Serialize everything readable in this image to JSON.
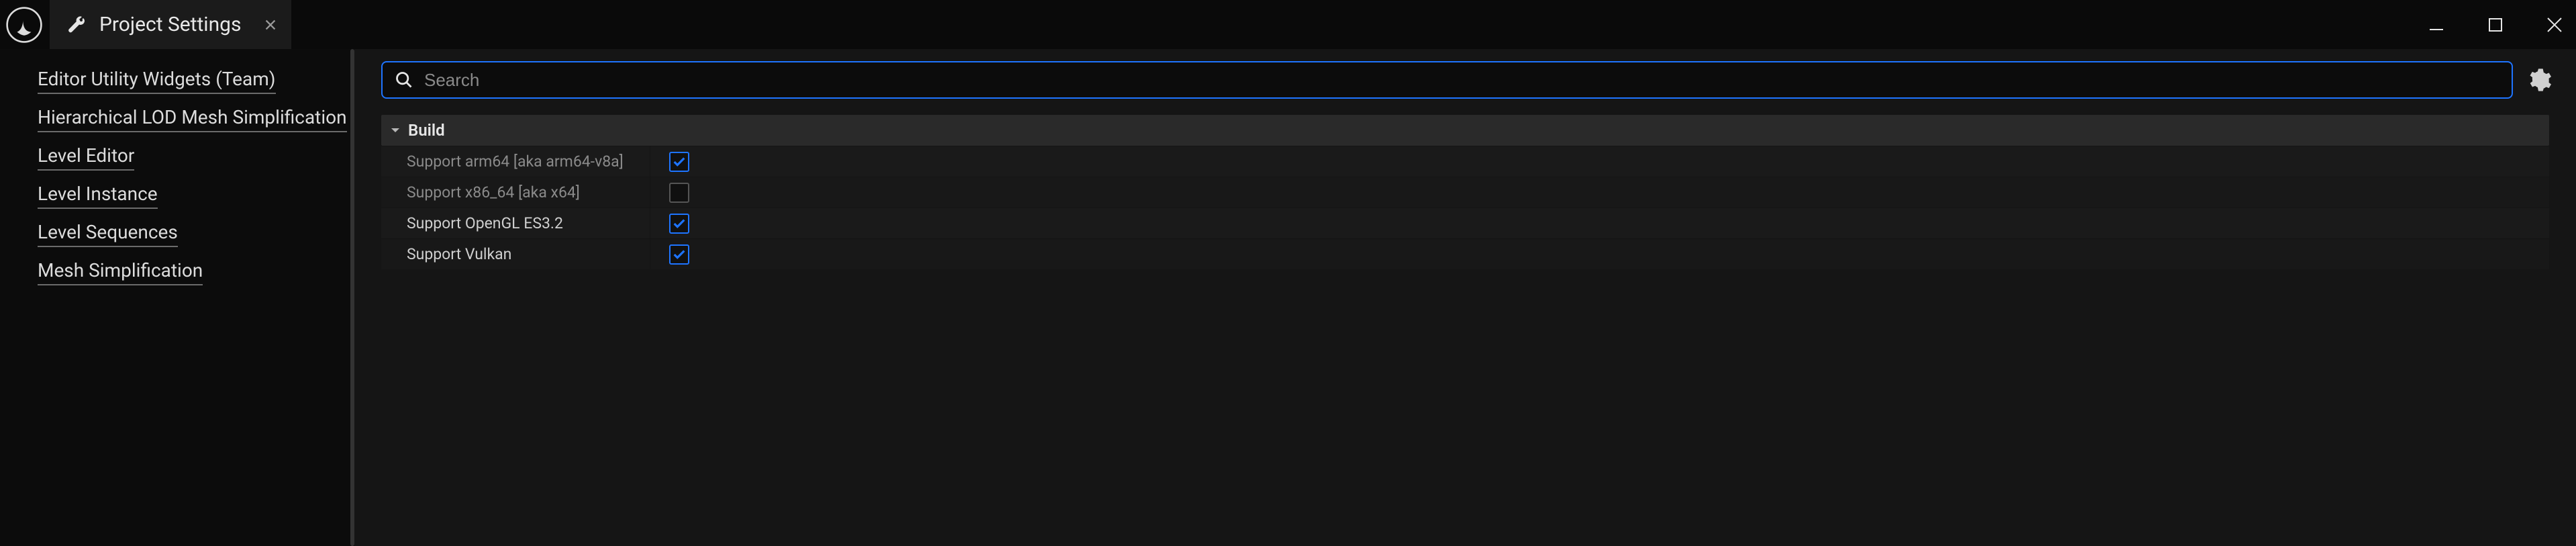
{
  "window": {
    "title": "Project Settings"
  },
  "nav": {
    "items": [
      "Editor Utility Widgets (Team)",
      "Hierarchical LOD Mesh Simplification",
      "Level Editor",
      "Level Instance",
      "Level Sequences",
      "Mesh Simplification"
    ]
  },
  "search": {
    "placeholder": "Search",
    "value": ""
  },
  "section": {
    "title": "Build",
    "rows": [
      {
        "label": "Support arm64 [aka arm64-v8a]",
        "checked": true,
        "dim": true
      },
      {
        "label": "Support x86_64 [aka x64]",
        "checked": false,
        "dim": true
      },
      {
        "label": "Support OpenGL ES3.2",
        "checked": true,
        "dim": false
      },
      {
        "label": "Support Vulkan",
        "checked": true,
        "dim": false
      }
    ]
  }
}
